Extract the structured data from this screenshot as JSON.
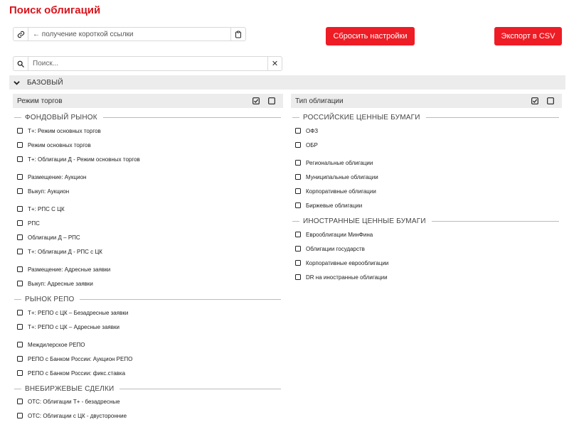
{
  "page": {
    "title": "Поиск облигаций"
  },
  "link": {
    "text": "← получение короткой ссылки"
  },
  "buttons": {
    "reset": "Сбросить настройки",
    "csv": "Экспорт в CSV"
  },
  "search": {
    "placeholder": "Поиск...",
    "clear": "✕"
  },
  "section": {
    "label": "БАЗОВЫЙ"
  },
  "panels": {
    "left": {
      "title": "Режим торгов",
      "groups": [
        {
          "label": "ФОНДОВЫЙ РЫНОК",
          "items": [
            "Т+: Режим основных торгов",
            "Режим основных торгов",
            "Т+: Облигации Д - Режим основных торгов",
            "Размещение: Аукцион",
            "Выкуп: Аукцион",
            "Т+: РПС С ЦК",
            "РПС",
            "Облигации Д – РПС",
            "Т+: Облигации Д - РПС с ЦК",
            "Размещение: Адресные заявки",
            "Выкуп: Адресные заявки"
          ]
        },
        {
          "label": "РЫНОК РЕПО",
          "items": [
            "Т+: РЕПО с ЦК – Безадресные заявки",
            "Т+: РЕПО с ЦК – Адресные заявки",
            "Междилерское РЕПО",
            "РЕПО с Банком России: Аукцион РЕПО",
            "РЕПО с Банком России: фикс.ставка"
          ]
        },
        {
          "label": "ВНЕБИРЖЕВЫЕ СДЕЛКИ",
          "items": [
            "OTC: Облигации Т+ - безадресные",
            "OTC: Облигации с ЦК - двусторонние"
          ]
        }
      ]
    },
    "right": {
      "title": "Тип облигации",
      "groups": [
        {
          "label": "РОССИЙСКИЕ ЦЕННЫЕ БУМАГИ",
          "items": [
            "ОФЗ",
            "ОБР",
            "Региональные облигации",
            "Муниципальные облигации",
            "Корпоративные облигации",
            "Биржевые облигации"
          ]
        },
        {
          "label": "ИНОСТРАННЫЕ ЦЕННЫЕ БУМАГИ",
          "items": [
            "Еврооблигации МинФина",
            "Облигации государств",
            "Корпоративные еврооблигации",
            "DR на иностранные облигации"
          ]
        }
      ]
    }
  },
  "icons": {
    "link": "link-icon",
    "copy": "clipboard-icon",
    "search": "search-icon",
    "clear": "close-icon",
    "chevron": "chevron-down-icon",
    "select_all": "check-all-icon",
    "clear_all": "checkbox-empty-icon"
  },
  "colors": {
    "accent": "#ee1c25",
    "title": "#d8141c",
    "bar": "#ececec"
  }
}
